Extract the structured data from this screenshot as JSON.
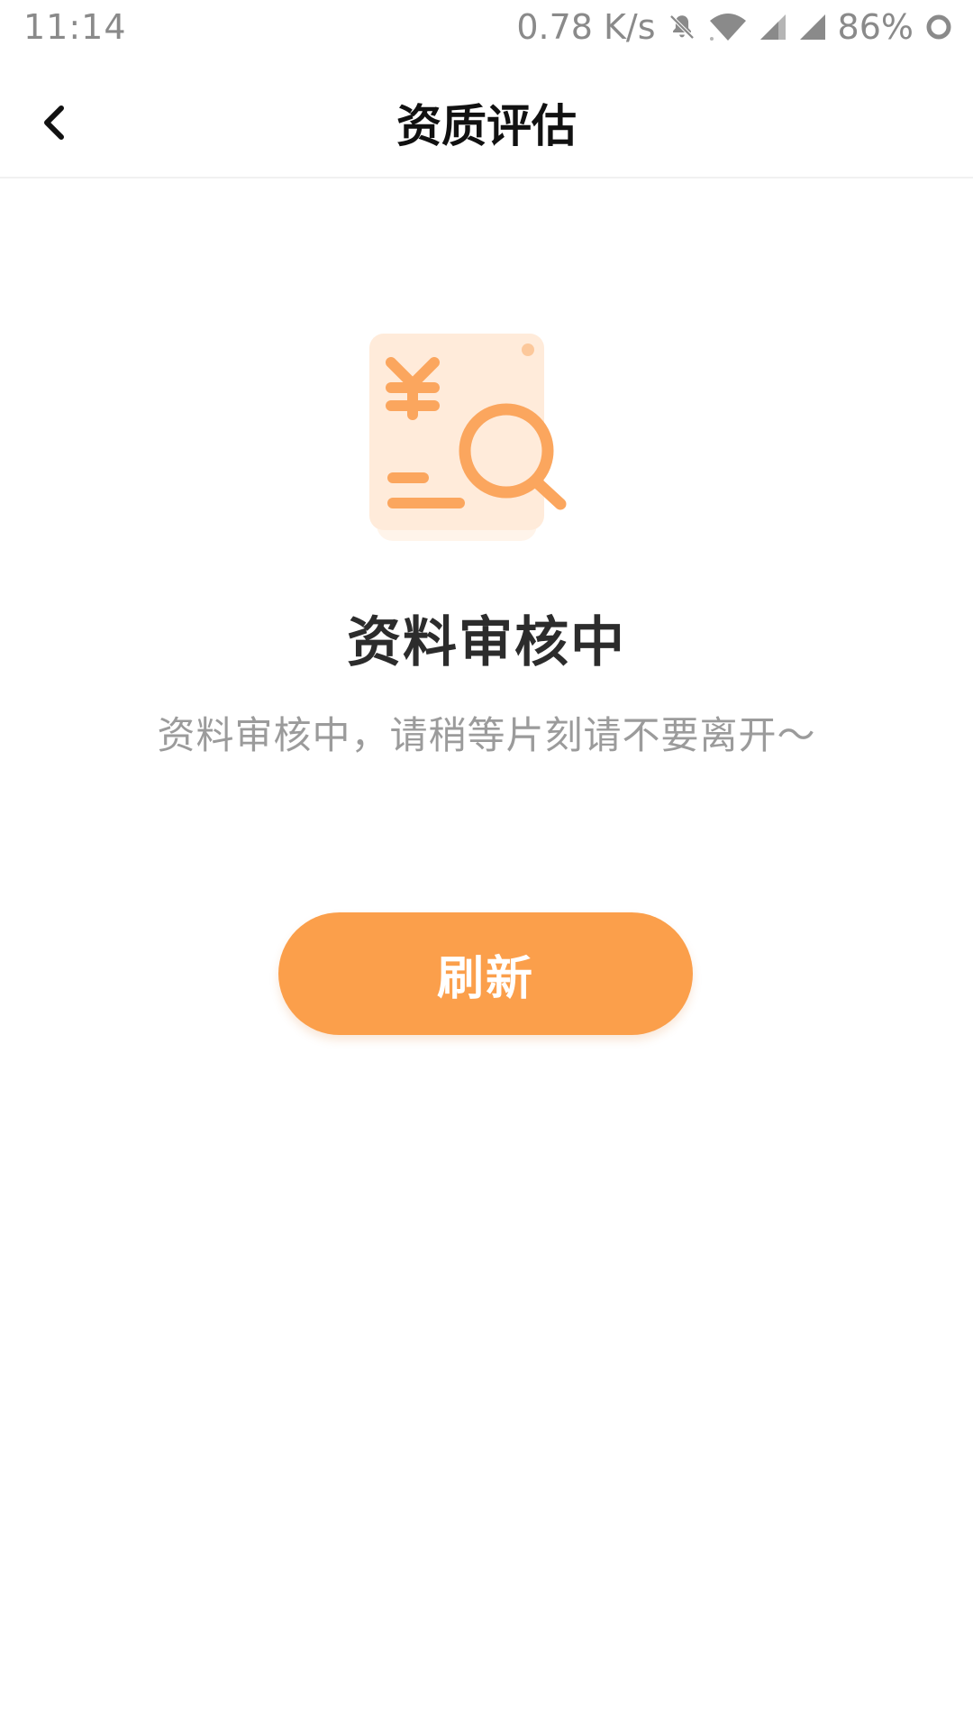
{
  "status_bar": {
    "time": "11:14",
    "network_speed": "0.78 K/s",
    "battery": "86%",
    "icons": [
      "bell-muted-icon",
      "wifi-icon",
      "signal-icon",
      "signal-icon",
      "battery-ring-icon"
    ]
  },
  "header": {
    "back_icon": "chevron-left-icon",
    "title": "资质评估"
  },
  "illustration": {
    "icon": "document-yen-search-icon",
    "colors": {
      "card": "#FFEBDA",
      "accent": "#FBA65E"
    }
  },
  "main": {
    "heading": "资料审核中",
    "message": "资料审核中，请稍等片刻请不要离开～"
  },
  "actions": {
    "refresh_label": "刷新"
  },
  "colors": {
    "primary": "#FB9F4B",
    "title": "#111111",
    "heading": "#2C2C2C",
    "subtext": "#9B9B9B",
    "status_text": "#8A8A8A"
  }
}
